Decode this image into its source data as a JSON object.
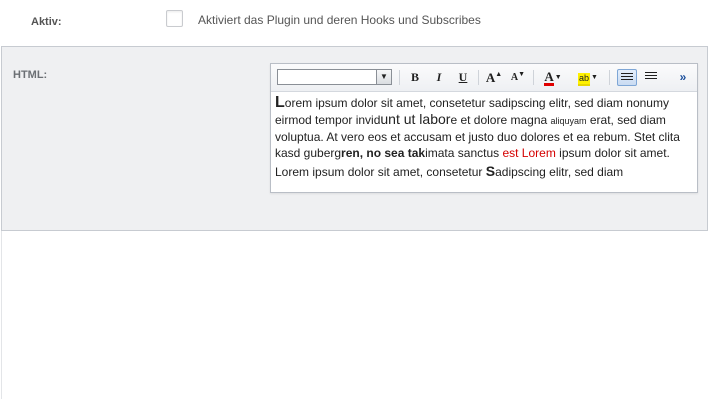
{
  "aktiv": {
    "label": "Aktiv:",
    "checked": false,
    "description": "Aktiviert das Plugin und deren Hooks und Subscribes"
  },
  "html_field": {
    "label": "HTML:",
    "toolbar": {
      "font_select_value": "",
      "buttons": [
        "bold-icon",
        "italic-icon",
        "underline-icon",
        "font-size-increase-icon",
        "font-size-decrease-icon",
        "text-color-icon",
        "highlight-color-icon",
        "align-left-icon",
        "align-center-icon",
        "more-options-icon"
      ],
      "bold": "B",
      "italic": "I",
      "underline": "U",
      "grow": "A",
      "shrink": "A",
      "text_color": "A",
      "highlight": "ab",
      "more": "»",
      "text_color_hex": "#e00000",
      "highlight_hex": "#fff100"
    },
    "content": {
      "p1": [
        {
          "t": "L",
          "s": "big-l"
        },
        {
          "t": "orem ipsum dolor sit amet, consetetur sadipscing elitr, sed diam nonumy eirmod tempor invid",
          "s": ""
        },
        {
          "t": "unt ut labor",
          "s": "mid"
        },
        {
          "t": "e et dolore magna ",
          "s": ""
        },
        {
          "t": "aliquyam",
          "s": "tiny"
        },
        {
          "t": " erat, sed diam voluptua. At vero eos et accusam et justo duo dolores et ea rebum. Stet clita kasd guberg",
          "s": ""
        },
        {
          "t": "ren, no sea tak",
          "s": "bold"
        },
        {
          "t": "imata sanctus ",
          "s": ""
        },
        {
          "t": "est Lorem",
          "s": "red"
        },
        {
          "t": " ipsum dolor sit amet.",
          "s": ""
        }
      ],
      "p2": [
        {
          "t": "Lorem ipsum dolor sit amet, consetetur ",
          "s": ""
        },
        {
          "t": "S",
          "s": "bigs"
        },
        {
          "t": "adipscing elitr, sed diam",
          "s": ""
        }
      ]
    }
  }
}
